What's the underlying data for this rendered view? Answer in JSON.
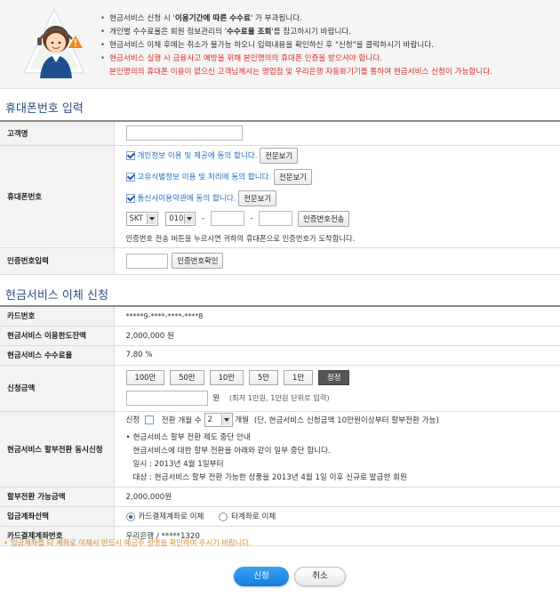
{
  "notice": {
    "l1a": "현금서비스 신청 시 '",
    "l1b": "이용기간에 따른 수수료",
    "l1c": "' 가 부과됩니다.",
    "l2a": "개인별 수수료율은 회원 정보관리의 '",
    "l2b": "수수료율 조회",
    "l2c": "'를 참고하시기 바랍니다.",
    "l3": "현금서비스 이체 후에는 취소가 불가능 하오니 입력내용을 확인하신 후 \"신청\"을 클릭하시기 바랍니다.",
    "l4": "현금서비스 실행 시 금융사고 예방을 위해 본인명의의 휴대폰 인증을 받으셔야 합니다.",
    "l5": "본인명의의 휴대폰 이용이 없으신 고객님께서는 영업점 및 우리은행 자동화기기를 통하여 현금서비스 신청이 가능합니다."
  },
  "section1": {
    "title": "휴대폰번호 입력",
    "customer_label": "고객명",
    "phone_label": "휴대폰번호",
    "agree1": "개인정보 이용 및 제공에 동의 합니다.",
    "agree2": "고유식별정보 이용 및 처리에 동의 합니다.",
    "agree3": "통신사이용약관에 동의 합니다.",
    "view_full": "전문보기",
    "carrier": "SKT",
    "prefix": "010",
    "dash": "-",
    "send_btn": "인증번호전송",
    "send_help": "인증번호 전송 버튼을 누르시면 귀하의 휴대폰으로 인증번호가 도착합니다.",
    "auth_label": "인증번호입력",
    "confirm_btn": "인증번호확인"
  },
  "section2": {
    "title": "현금서비스 이체 신청",
    "rows": {
      "card_label": "카드번호",
      "card_value": "*****9-****-****-****8",
      "limit_label": "현금서비스 이용한도잔액",
      "limit_value": "2,000,000 원",
      "fee_label": "현금서비스 수수료율",
      "fee_value": "7.80 %",
      "amount_label": "신청금액",
      "amount_unit": "원",
      "amount_help": "(최저 1만원, 1만원 단위로 입력)",
      "install_label": "현금서비스 할부전환 동시신청",
      "install_apply": "신청",
      "install_months_label": "전환 개월 수",
      "install_months": "2",
      "install_months_unit": "개월",
      "install_help": "(단, 현금서비스 신청금액 10만원이상부터 할부전환 가능)",
      "install_n1": "현금서비스 할부 전환 제도 중단 안내",
      "install_n2": "현금서비스에 대한 할부 전환을 아래와 같이 일부 중단 합니다.",
      "install_n3": "일시 : 2013년 4월 1일부터",
      "install_n4": "대상 : 현금서비스 할부 전환 가능한 상품을 2013년 4월 1일 이후 신규로 발급한 회원",
      "possible_label": "할부전환 가능금액",
      "possible_value": "2,000,000원",
      "account_label": "입금계좌선택",
      "account_opt1": "카드결제계좌로 이체",
      "account_opt2": "타계좌로 이체",
      "pay_label": "카드결제계좌번호",
      "pay_value": "우리은행 / *****1320"
    },
    "amount_buttons": [
      "100만",
      "50만",
      "10만",
      "5만",
      "1만",
      "정정"
    ]
  },
  "footnote": "입금계좌를 타 계좌로 이체시 반드시 예금주 성명을 확인하여 주시기 바랍니다.",
  "actions": {
    "submit": "신청",
    "cancel": "취소"
  }
}
